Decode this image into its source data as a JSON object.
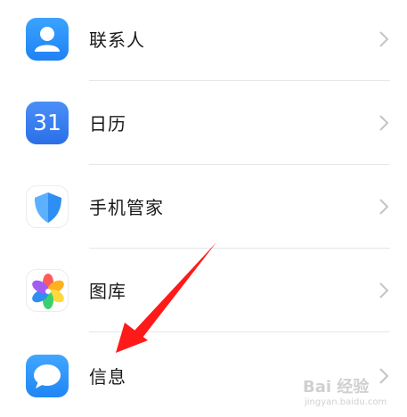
{
  "settings_list": {
    "items": [
      {
        "label": "联系人",
        "icon": "contacts-icon"
      },
      {
        "label": "日历",
        "icon": "calendar-icon",
        "icon_text": "31"
      },
      {
        "label": "手机管家",
        "icon": "phone-manager-shield-icon"
      },
      {
        "label": "图库",
        "icon": "gallery-pinwheel-icon"
      },
      {
        "label": "信息",
        "icon": "messages-bubble-icon"
      }
    ],
    "chevron_icon": "chevron-right-icon"
  },
  "annotation": {
    "arrow_color": "#ff1a1a",
    "points_to": "信息"
  },
  "watermark": {
    "text": "Bai 经验",
    "sub": "jingyan.baidu.com"
  },
  "colors": {
    "accent_blue": "#1f82f5",
    "divider": "#e6e6e6",
    "chevron": "#c4c4c4"
  }
}
